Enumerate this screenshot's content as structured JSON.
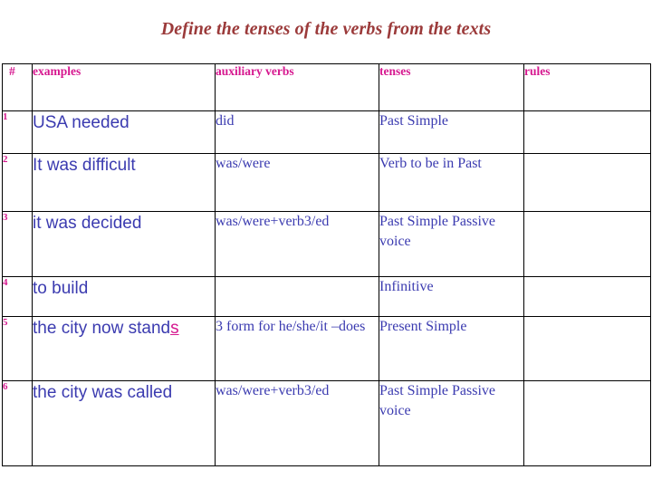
{
  "slide": {
    "title": "Define the tenses of the verbs from the texts",
    "title_color": "#9b3a3a",
    "header_color": "#d6188f",
    "body_text_color": "#3b3bb0"
  },
  "table": {
    "columns": [
      {
        "key": "num",
        "label": "#"
      },
      {
        "key": "examples",
        "label": "examples"
      },
      {
        "key": "auxiliary",
        "label": "auxiliary verbs"
      },
      {
        "key": "tenses",
        "label": "tenses"
      },
      {
        "key": "rules",
        "label": "rules"
      }
    ],
    "rows": [
      {
        "num": "1",
        "example": "USA needed",
        "example_highlight": "",
        "auxiliary": "did",
        "tenses": "Past Simple",
        "rules": ""
      },
      {
        "num": "2",
        "example": "It was difficult",
        "example_highlight": "",
        "auxiliary": "was/were",
        "tenses": "Verb to be in Past",
        "rules": ""
      },
      {
        "num": "3",
        "example": "it was decided",
        "example_highlight": "",
        "auxiliary": "was/were+verb3/ed",
        "tenses": "Past Simple Passive voice",
        "rules": ""
      },
      {
        "num": "4",
        "example": "to build",
        "example_highlight": "",
        "auxiliary": "",
        "tenses": "Infinitive",
        "rules": ""
      },
      {
        "num": "5",
        "example": "the city now stand",
        "example_highlight": "s",
        "auxiliary": "3 form for he/she/it –does",
        "tenses": "Present Simple",
        "rules": ""
      },
      {
        "num": "6",
        "example": "the city was called",
        "example_highlight": "",
        "auxiliary": "was/were+verb3/ed",
        "tenses": "Past Simple Passive voice",
        "rules": ""
      }
    ]
  }
}
